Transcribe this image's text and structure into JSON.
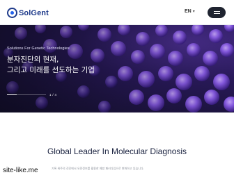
{
  "header": {
    "logo_text": "SolGent",
    "language": "EN",
    "menu_icon": "hamburger-icon"
  },
  "hero": {
    "tagline": "Solutions For Genetic Technologies",
    "headline_line1": "분자진단의 현재,",
    "headline_line2": "그리고 미래를 선도하는 기업",
    "page_indicator": "1 / 4",
    "progress": 0.25,
    "accent_color": "#7b4fe0"
  },
  "main": {
    "title": "Global Leader In Molecular Diagnosis",
    "description": "기록 위주의 진단에서 유전정보를 활용한 예방 패러다임으로 변화하고 있습니다."
  },
  "watermark": "site-like.me"
}
